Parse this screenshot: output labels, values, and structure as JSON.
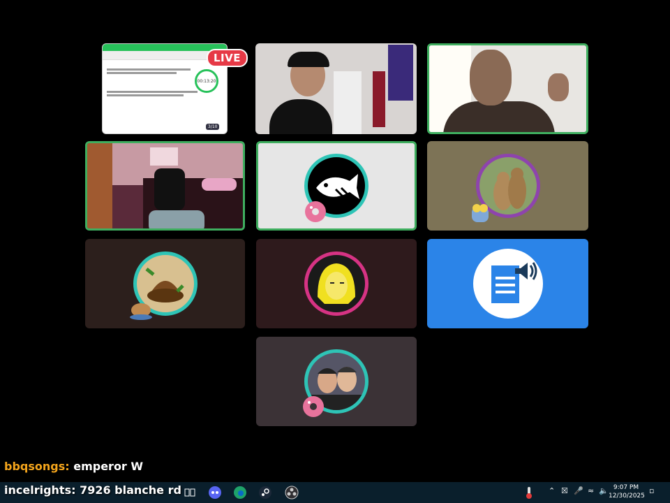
{
  "stream": {
    "live_label": "LIVE"
  },
  "browser_tile": {
    "timer": "00:13:20",
    "badge": "3/10"
  },
  "chat": [
    {
      "user": "bbqsongs:",
      "message": "emperor W"
    },
    {
      "user": "incelrights:",
      "message": "7926 blanche rd"
    }
  ],
  "taskbar": {
    "time": "9:07 PM",
    "date": "12/30/2025"
  },
  "colors": {
    "speaking_border": "#3fae5f",
    "tile_gray": "#3b3236",
    "tile_brown": "#2c1f1c",
    "tile_olive": "#7d7356",
    "tile_blue": "#2b84e8"
  }
}
